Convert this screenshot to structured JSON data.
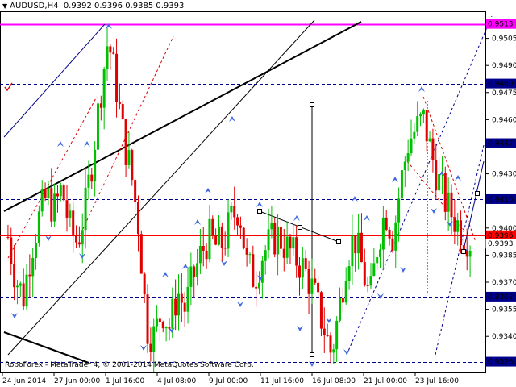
{
  "window": {
    "symbol_label": "AUDUSD,H4",
    "ohlc": [
      "0.9392",
      "0.9396",
      "0.9385",
      "0.9393"
    ],
    "copyright": "RoboForex - MetaTrader 4, © 2001-2014 MetaQuotes Software Corp."
  },
  "price_axis": {
    "ticks": [
      "0.9505",
      "0.9490",
      "0.9475",
      "0.9460",
      "0.9430",
      "0.9400",
      "0.9385",
      "0.9370",
      "0.9355",
      "0.9340"
    ],
    "levels": [
      {
        "label": "0.9513",
        "value": 0.9513,
        "color": "#ff00ff",
        "style": "solid",
        "width": 2
      },
      {
        "label": "0.9480",
        "value": 0.948,
        "color": "#00008b",
        "style": "dashed",
        "width": 1
      },
      {
        "label": "0.9447",
        "value": 0.9447,
        "color": "#00008b",
        "style": "dashed",
        "width": 1
      },
      {
        "label": "0.9416",
        "value": 0.9416,
        "color": "#00008b",
        "style": "dashed",
        "width": 1
      },
      {
        "label": "0.9396",
        "value": 0.9396,
        "color": "#ff0000",
        "style": "solid",
        "width": 1
      },
      {
        "label": "0.9362",
        "value": 0.9362,
        "color": "#00008b",
        "style": "dashed",
        "width": 1
      },
      {
        "label": "0.9326",
        "value": 0.9326,
        "color": "#00008b",
        "style": "dashed",
        "width": 1
      }
    ],
    "bid_label": "0.9393"
  },
  "time_axis": {
    "ticks": [
      "24 Jun 2014",
      "27 Jun 00:00",
      "1 Jul 16:00",
      "4 Jul 08:00",
      "9 Jul 00:00",
      "11 Jul 16:00",
      "16 Jul 08:00",
      "21 Jul 00:00",
      "23 Jul 16:00"
    ]
  },
  "colors": {
    "bull": "#00c000",
    "bear": "#e00000",
    "grid_level": "#00008b",
    "bid": "#ff0000",
    "resistance": "#ff00ff",
    "trend": "#000000",
    "arrow": "#4169e1"
  },
  "chart_data": {
    "type": "candlestick",
    "title": "AUDUSD,H4",
    "ylim": [
      0.932,
      0.952
    ],
    "x_categories": [
      "24 Jun 2014",
      "27 Jun 00:00",
      "1 Jul 16:00",
      "4 Jul 08:00",
      "9 Jul 00:00",
      "11 Jul 16:00",
      "16 Jul 08:00",
      "21 Jul 00:00",
      "23 Jul 16:00"
    ],
    "close_path": [
      0.9395,
      0.9372,
      0.9362,
      0.9388,
      0.9405,
      0.9418,
      0.941,
      0.9422,
      0.94,
      0.9392,
      0.941,
      0.944,
      0.9475,
      0.9505,
      0.948,
      0.945,
      0.943,
      0.94,
      0.9345,
      0.934,
      0.9355,
      0.9345,
      0.9365,
      0.9355,
      0.9372,
      0.9385,
      0.9395,
      0.939,
      0.9392,
      0.9405,
      0.9412,
      0.938,
      0.9372,
      0.9385,
      0.9392,
      0.9396,
      0.939,
      0.9385,
      0.938,
      0.9372,
      0.936,
      0.9345,
      0.933,
      0.9355,
      0.9385,
      0.9395,
      0.9378,
      0.936,
      0.9392,
      0.941,
      0.9395,
      0.9425,
      0.9448,
      0.9455,
      0.946,
      0.944,
      0.9425,
      0.9412,
      0.9405,
      0.9398,
      0.9393
    ]
  }
}
